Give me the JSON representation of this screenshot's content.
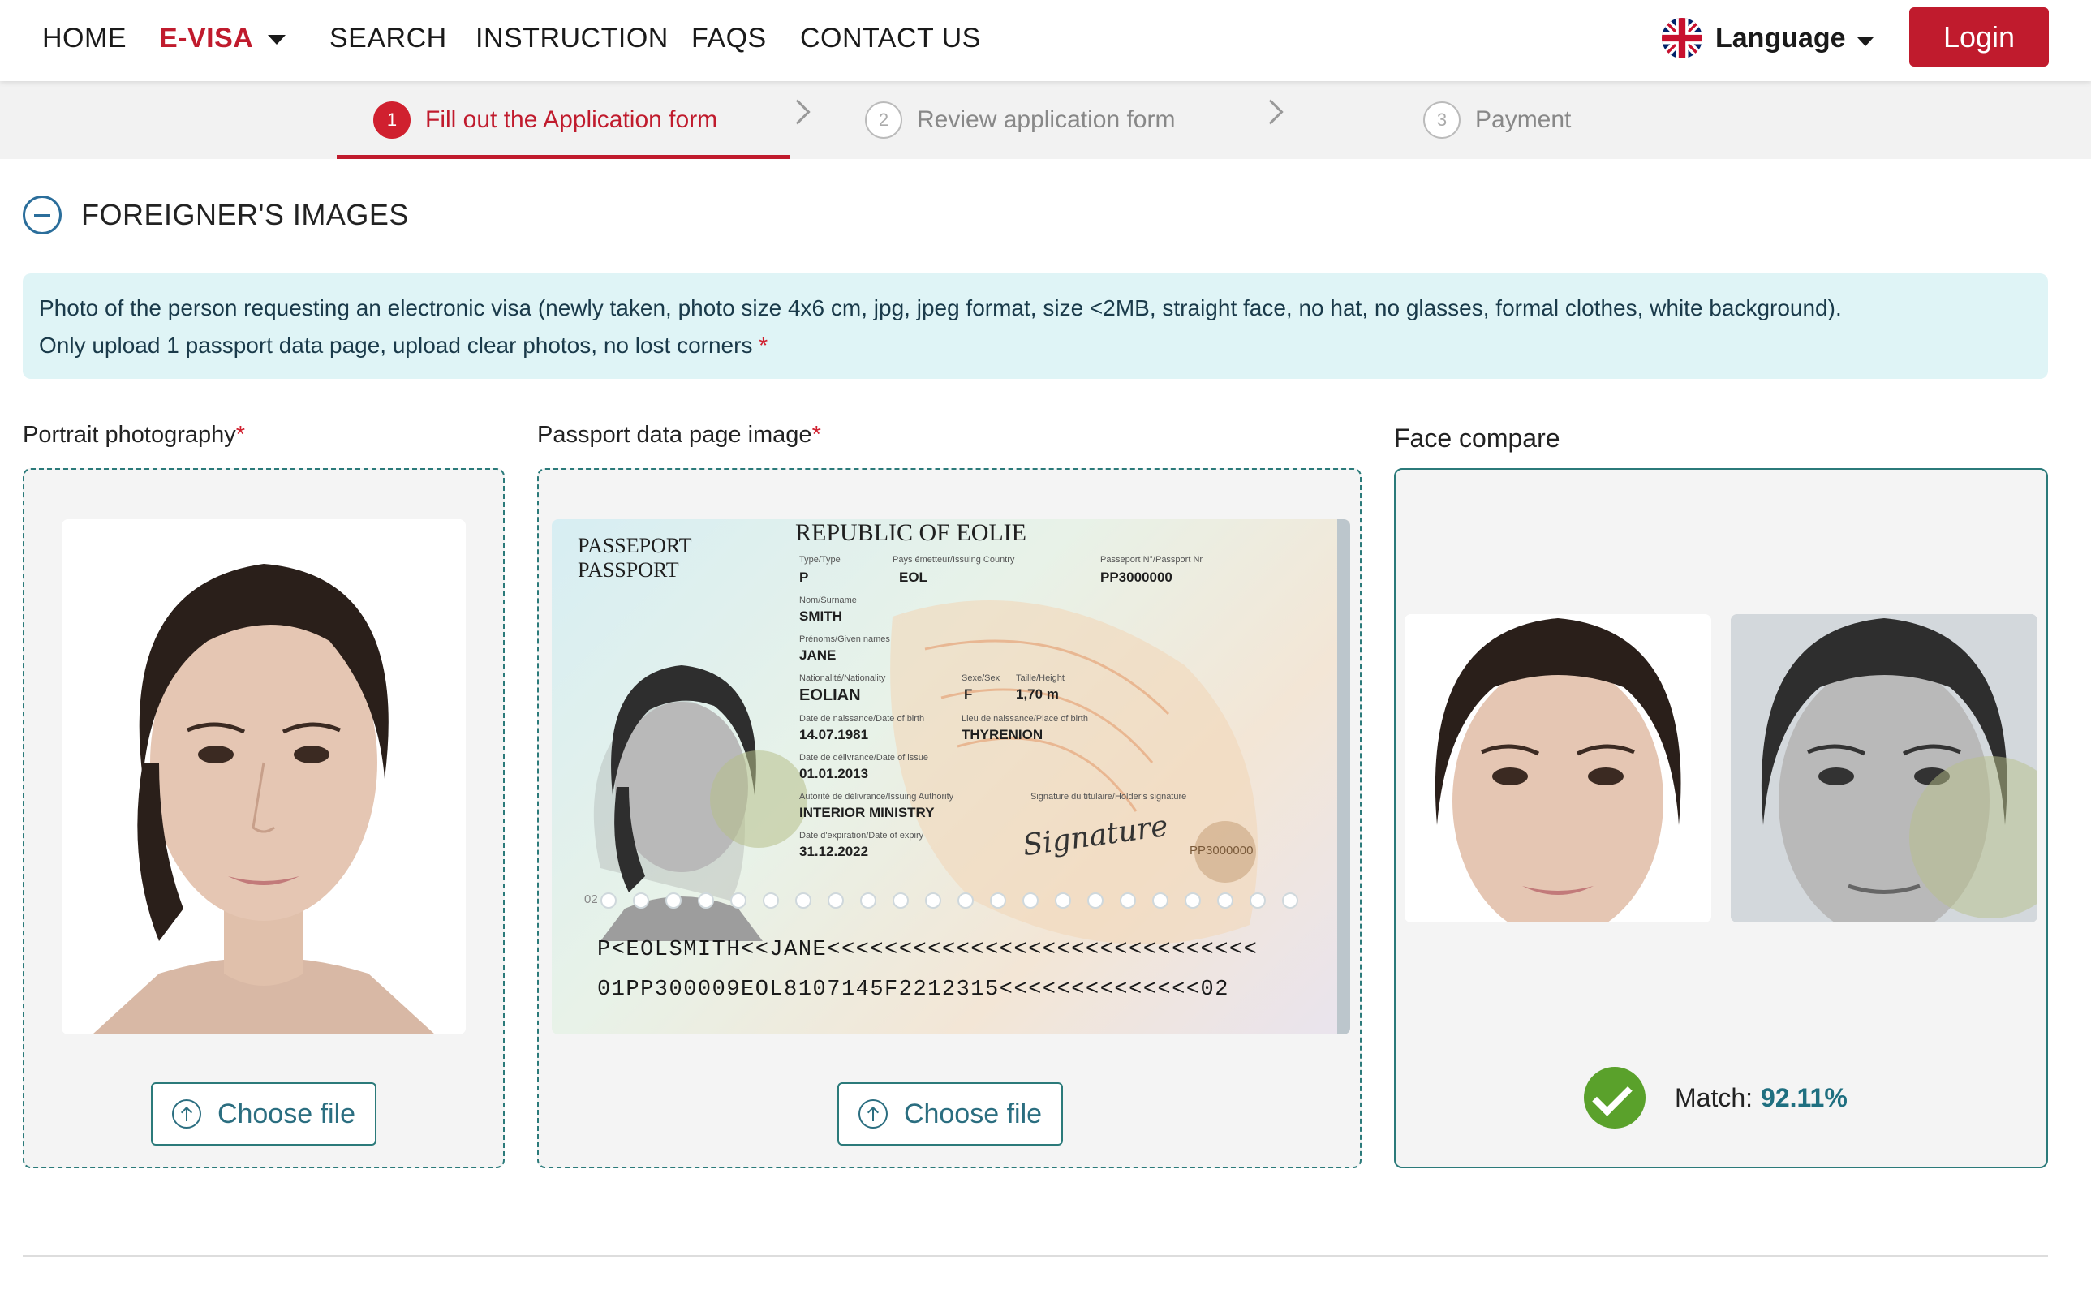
{
  "nav": {
    "home": "HOME",
    "evisa": "E-VISA",
    "search": "SEARCH",
    "instruction": "INSTRUCTION",
    "faqs": "FAQS",
    "contact": "CONTACT US",
    "language": "Language",
    "login": "Login"
  },
  "stepper": {
    "steps": [
      {
        "num": "1",
        "label": "Fill out the Application form",
        "active": true
      },
      {
        "num": "2",
        "label": "Review application form",
        "active": false
      },
      {
        "num": "3",
        "label": "Payment",
        "active": false
      }
    ]
  },
  "section": {
    "title": "FOREIGNER'S IMAGES",
    "notice_line1": "Photo of the person requesting an electronic visa (newly taken, photo size 4x6 cm, jpg, jpeg format, size <2MB, straight face, no hat, no glasses, formal clothes, white background).",
    "notice_line2": "Only upload 1 passport data page, upload clear photos, no lost corners",
    "required_mark": "*"
  },
  "portrait": {
    "label": "Portrait photography",
    "button": "Choose file"
  },
  "passport": {
    "label": "Passport data page image",
    "button": "Choose file",
    "country": "REPUBLIC OF EOLIE",
    "doc_title1": "PASSEPORT",
    "doc_title2": "PASSPORT",
    "type_label": "Type/Type",
    "type_value": "P",
    "issuing_label": "Pays émetteur/Issuing Country",
    "issuing_value": "EOL",
    "number_label": "Passeport N°/Passport Nr",
    "number_value": "PP3000000",
    "surname_label": "Nom/Surname",
    "surname_value": "SMITH",
    "given_label": "Prénoms/Given names",
    "given_value": "JANE",
    "nationality_label": "Nationalité/Nationality",
    "nationality_value": "EOLIAN",
    "sex_label": "Sexe/Sex",
    "sex_value": "F",
    "height_label": "Taille/Height",
    "height_value": "1,70 m",
    "dob_label": "Date de naissance/Date of birth",
    "dob_value": "14.07.1981",
    "pob_label": "Lieu de naissance/Place of birth",
    "pob_value": "THYRENION",
    "issue_label": "Date de délivrance/Date of issue",
    "issue_value": "01.01.2013",
    "authority_label": "Autorité de délivrance/Issuing Authority",
    "authority_value": "INTERIOR MINISTRY",
    "expiry_label": "Date d'expiration/Date of expiry",
    "expiry_value": "31.12.2022",
    "signature_label": "Signature du titulaire/Holder's signature",
    "signature_value": "Signature",
    "stamp_value": "PP3000000",
    "page_code": "02",
    "mrz1": "P<EOLSMITH<<JANE<<<<<<<<<<<<<<<<<<<<<<<<<<<<<<",
    "mrz2": "01PP300009EOL8107145F2212315<<<<<<<<<<<<<<02"
  },
  "face_compare": {
    "label": "Face compare",
    "match_label": "Match:",
    "match_value": "92.11%"
  },
  "colors": {
    "brand_red": "#c01b2d",
    "teal": "#2b7a7a",
    "notice_bg": "#dff4f6",
    "match_green": "#5aa12b"
  }
}
